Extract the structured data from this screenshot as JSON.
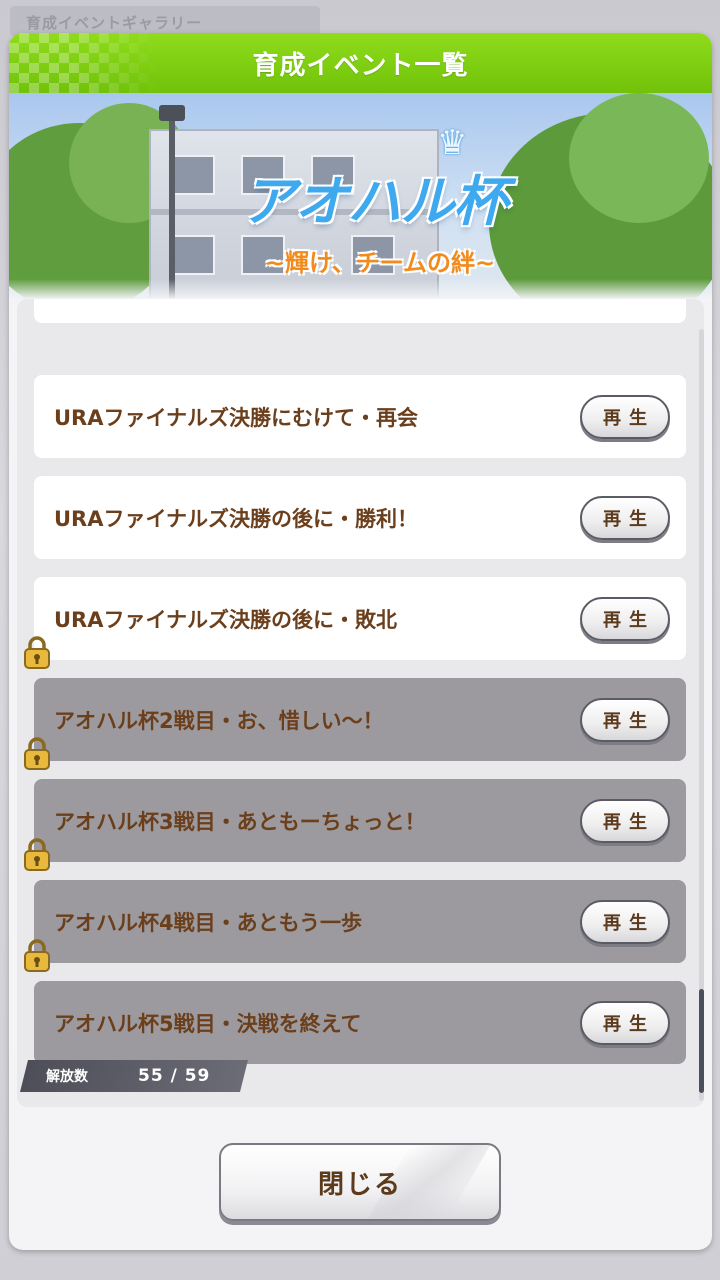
{
  "background": {
    "ghost_tab_label": "育成イベントギャラリー"
  },
  "dialog": {
    "title": "育成イベント一覧",
    "banner": {
      "logo_main": "アオハル杯",
      "logo_sub": "~輝け、チームの絆~"
    },
    "events": [
      {
        "title": "URAファイナルズ決勝にむけて・再会",
        "locked": false,
        "button": "再生"
      },
      {
        "title": "URAファイナルズ決勝の後に・勝利！",
        "locked": false,
        "button": "再生"
      },
      {
        "title": "URAファイナルズ決勝の後に・敗北",
        "locked": false,
        "button": "再生"
      },
      {
        "title": "アオハル杯2戦目・お、惜しい～！",
        "locked": true,
        "button": "再生"
      },
      {
        "title": "アオハル杯3戦目・あともーちょっと！",
        "locked": true,
        "button": "再生"
      },
      {
        "title": "アオハル杯4戦目・あともう一歩",
        "locked": true,
        "button": "再生"
      },
      {
        "title": "アオハル杯5戦目・決戦を終えて",
        "locked": true,
        "button": "再生"
      }
    ],
    "release": {
      "label": "解放数",
      "count": "55 / 59"
    },
    "close_button": "閉じる"
  },
  "colors": {
    "header_green": "#7ccc0f",
    "title_brown": "#6b3f1c",
    "locked_row": "#9c9a9e",
    "lock_gold": "#e5b43a"
  }
}
